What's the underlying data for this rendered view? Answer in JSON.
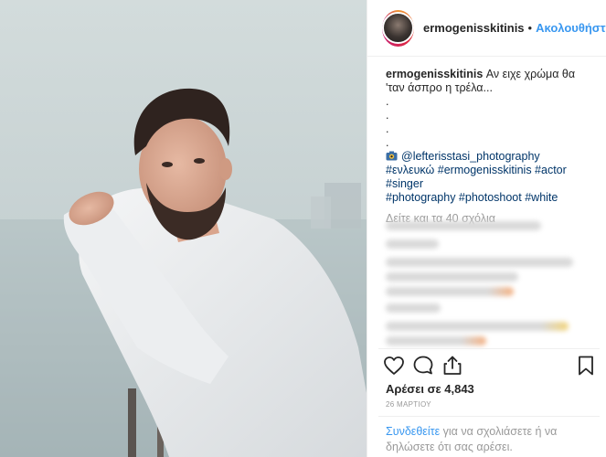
{
  "post": {
    "username": "ermogenisskitinis",
    "separator": "•",
    "follow_label": "Ακολουθήστε",
    "caption": "Αν ειχε χρώμα θα 'ταν άσπρο η τρέλα...",
    "dots": [
      ".",
      ".",
      ".",
      "."
    ],
    "photographer": "@lefterisstasi_photography",
    "hashtags_line1": "#ενλευκώ #ermogenisskitinis #actor #singer",
    "hashtags_line2": "#photography #photoshoot #white",
    "view_all_comments": "Δείτε και τα 40 σχόλια",
    "likes": "Αρέσει σε 4,843",
    "date": "26 ΜΑΡΤΙΟΥ",
    "login_link": "Συνδεθείτε",
    "login_text": "για να σχολιάσετε ή να δηλώσετε ότι σας αρέσει."
  },
  "icons": {
    "like": "heart-icon",
    "comment": "comment-icon",
    "share": "share-icon",
    "save": "bookmark-icon",
    "photographer_emoji": "camera-icon"
  },
  "colors": {
    "link_blue": "#3897f0",
    "hashtag_navy": "#003569",
    "muted_gray": "#999999"
  }
}
